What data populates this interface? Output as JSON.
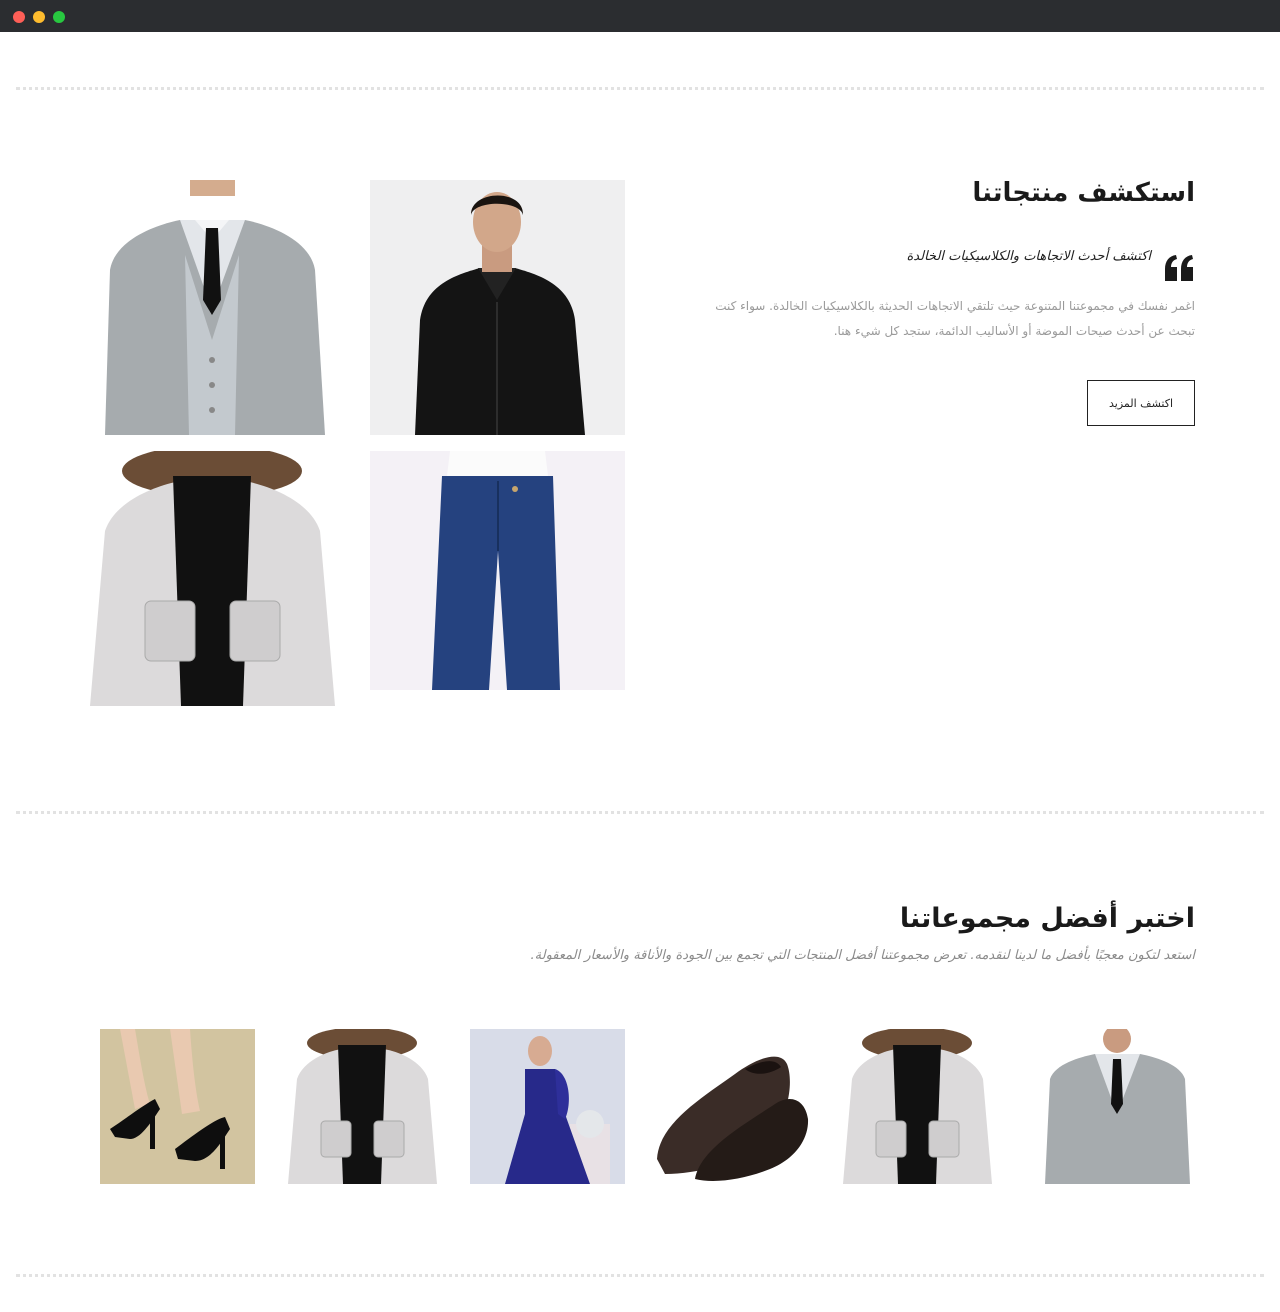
{
  "window": {
    "controls": [
      "close",
      "minimize",
      "maximize"
    ]
  },
  "explore": {
    "title": "استكشف منتجاتنا",
    "quote": "اكتشف أحدث الاتجاهات والكلاسيكيات الخالدة",
    "body": "اغمر نفسك في مجموعتنا المتنوعة حيث تلتقي الاتجاهات الحديثة بالكلاسيكيات الخالدة. سواء كنت تبحث عن أحدث صيحات الموضة أو الأساليب الدائمة، ستجد كل شيء هنا.",
    "button": "اكتشف المزيد",
    "images": [
      {
        "name": "black-shirt-man"
      },
      {
        "name": "grey-suit-man"
      },
      {
        "name": "blue-jeans"
      },
      {
        "name": "white-winter-jacket"
      }
    ]
  },
  "collections": {
    "title": "اختبر أفضل مجموعاتنا",
    "subtitle": "استعد لتكون معجبًا بأفضل ما لدينا لنقدمه. تعرض مجموعتنا أفضل المنتجات التي تجمع بين الجودة والأناقة والأسعار المعقولة.",
    "products": [
      {
        "name": "grey-suit"
      },
      {
        "name": "white-jacket"
      },
      {
        "name": "leather-shoes"
      },
      {
        "name": "blue-evening-dress"
      },
      {
        "name": "white-jacket-2"
      },
      {
        "name": "black-heels"
      }
    ]
  },
  "colors": {
    "heading": "#1a1a1a",
    "muted": "#9a9a9a",
    "divider": "#e2e2e2",
    "titlebar": "#2b2d30"
  }
}
